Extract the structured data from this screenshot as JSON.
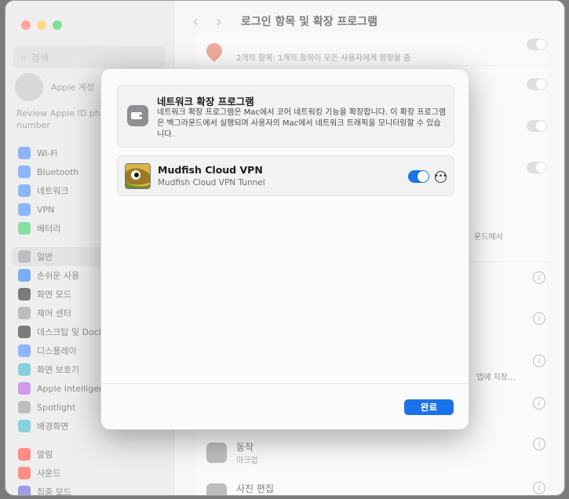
{
  "sidebar": {
    "search_placeholder": "검색",
    "account_label": "Apple 계정",
    "review_text": "Review Apple ID phone number",
    "items": [
      {
        "label": "Wi-Fi",
        "color": "#3b82f6"
      },
      {
        "label": "Bluetooth",
        "color": "#3b82f6"
      },
      {
        "label": "네트워크",
        "color": "#3b82f6"
      },
      {
        "label": "VPN",
        "color": "#3b82f6"
      },
      {
        "label": "배터리",
        "color": "#34c759"
      },
      {
        "label": "일반",
        "color": "#8e8e93"
      },
      {
        "label": "손쉬운 사용",
        "color": "#1a73e8"
      },
      {
        "label": "화면 모드",
        "color": "#1d1d1f"
      },
      {
        "label": "제어 센터",
        "color": "#8e8e93"
      },
      {
        "label": "데스크탑 및 Dock",
        "color": "#1d1d1f"
      },
      {
        "label": "디스플레이",
        "color": "#3b82f6"
      },
      {
        "label": "화면 보호기",
        "color": "#30b0c7"
      },
      {
        "label": "Apple Intelligence",
        "color": "#af52de"
      },
      {
        "label": "Spotlight",
        "color": "#8e8e93"
      },
      {
        "label": "배경화면",
        "color": "#30b0c7"
      },
      {
        "label": "알림",
        "color": "#ff3b30"
      },
      {
        "label": "사운드",
        "color": "#ff3b30"
      },
      {
        "label": "집중 모드",
        "color": "#5856d6"
      }
    ]
  },
  "main": {
    "title": "로그인 항목 및 확장 프로그램",
    "row1_sub": "2개의 항목: 1개의 항목이 모든 사용자에게 영향을 줌",
    "partial_right_1": "운드에서",
    "partial_right_2": "앱에 저장...",
    "bottom_row_1_title": "동작",
    "bottom_row_1_sub": "마크업",
    "bottom_row_2_title": "사진 편집"
  },
  "dialog": {
    "ext_title": "네트워크 확장 프로그램",
    "ext_desc": "네트워크 확장 프로그램은 Mac에서 코어 네트워킹 기능을 확장합니다. 이 확장 프로그램은 백그라운드에서 실행되며 사용자의 Mac에서 네트워크 트래픽을 모니터링할 수 있습니다.",
    "vpn_name": "Mudfish Cloud VPN",
    "vpn_sub": "Mudfish Cloud VPN Tunnel",
    "vpn_enabled": true,
    "done_label": "완료"
  }
}
